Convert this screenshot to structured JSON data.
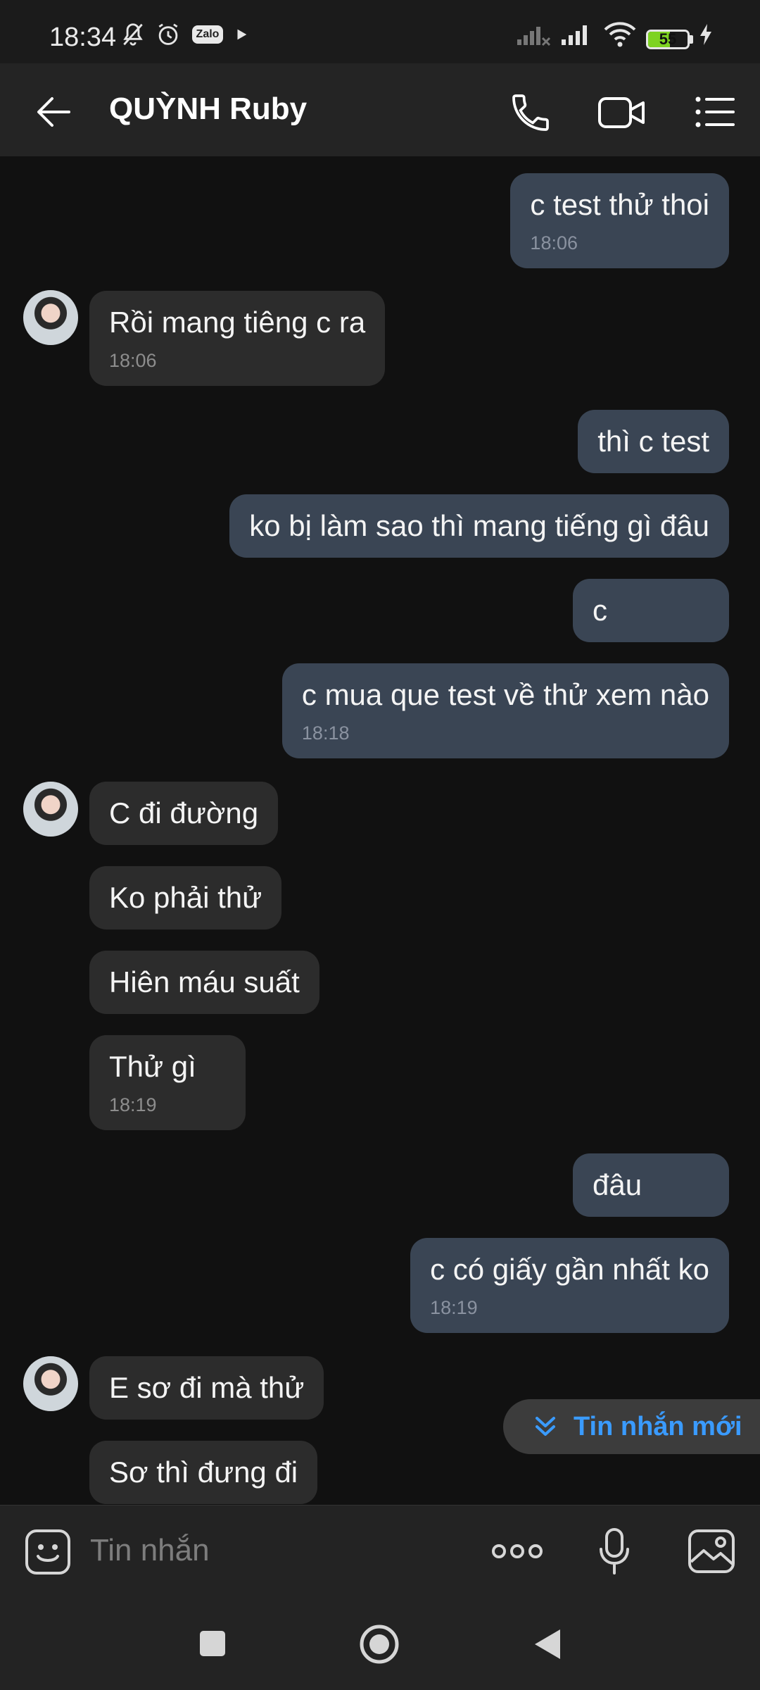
{
  "status_bar": {
    "time": "18:34",
    "battery": "55",
    "icons": [
      "notifications-off-icon",
      "alarm-icon",
      "zalo-icon",
      "play-icon",
      "signal-icon",
      "signal-icon",
      "wifi-icon",
      "battery-icon",
      "charging-icon"
    ],
    "zalo_label": "Zalo"
  },
  "header": {
    "title": "QUỲNH Ruby"
  },
  "messages": [
    {
      "text": "c test thử thoi",
      "time": "18:06"
    },
    {
      "text": "Rồi mang tiêng c ra",
      "time": "18:06"
    },
    {
      "text": "thì c test"
    },
    {
      "text": "ko bị làm sao thì mang tiếng gì đâu"
    },
    {
      "text": "c"
    },
    {
      "text": "c mua que test về thử xem nào",
      "time": "18:18"
    },
    {
      "text": "C đi đường"
    },
    {
      "text": "Ko phải thử"
    },
    {
      "text": "Hiên máu suất"
    },
    {
      "text": "Thử gì",
      "time": "18:19"
    },
    {
      "text": "đâu"
    },
    {
      "text": "c có giấy gần nhất ko",
      "time": "18:19"
    },
    {
      "text": "E sơ đi mà thử"
    },
    {
      "text": "Sơ thì đưng đi"
    }
  ],
  "new_messages_button": {
    "label": "Tin nhắn mới"
  },
  "composer": {
    "placeholder": "Tin nhắn"
  },
  "colors": {
    "background": "#111111",
    "outgoing_bubble": "#3a4554",
    "incoming_bubble": "#2c2c2c",
    "accent": "#3a9bff"
  }
}
